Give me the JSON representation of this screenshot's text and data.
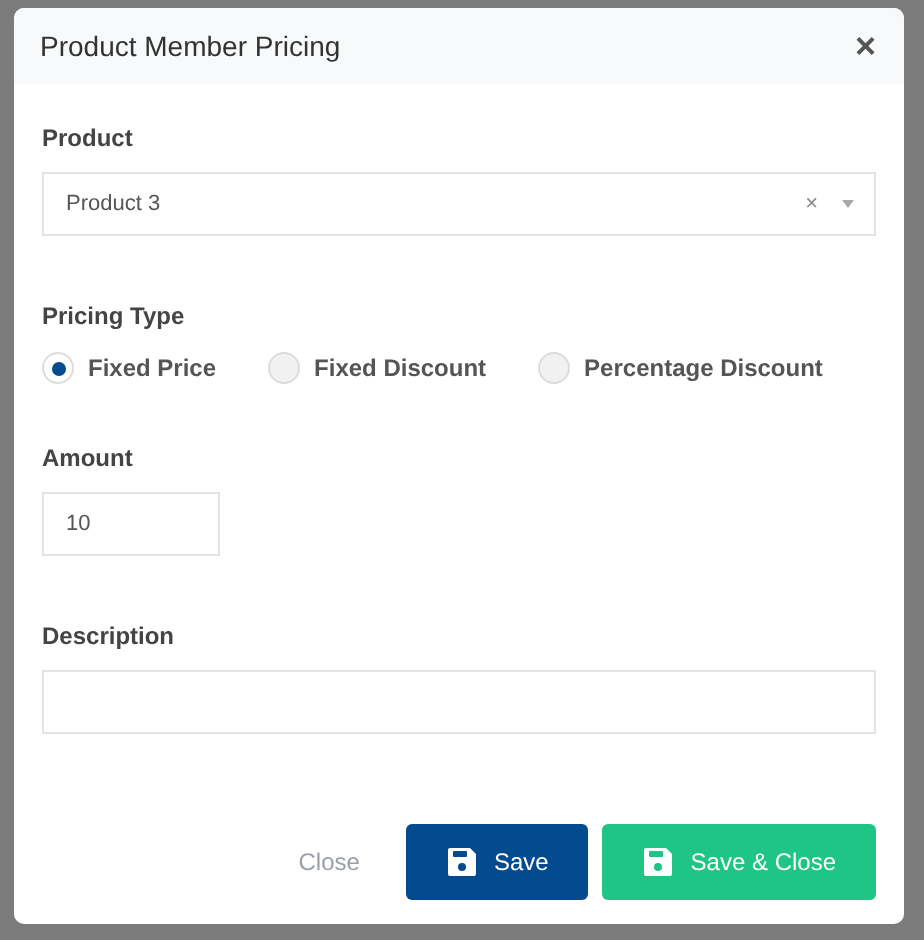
{
  "modal": {
    "title": "Product Member Pricing",
    "close_icon": "×"
  },
  "product": {
    "label": "Product",
    "value": "Product 3",
    "clear": "×"
  },
  "pricing_type": {
    "label": "Pricing Type",
    "options": [
      {
        "label": "Fixed Price",
        "selected": true
      },
      {
        "label": "Fixed Discount",
        "selected": false
      },
      {
        "label": "Percentage Discount",
        "selected": false
      }
    ]
  },
  "amount": {
    "label": "Amount",
    "value": "10"
  },
  "description": {
    "label": "Description"
  },
  "buttons": [
    {
      "kind": "link",
      "label": "Close"
    },
    {
      "kind": "primary",
      "label": "Save"
    },
    {
      "kind": "success",
      "label": "Save & Close"
    }
  ]
}
